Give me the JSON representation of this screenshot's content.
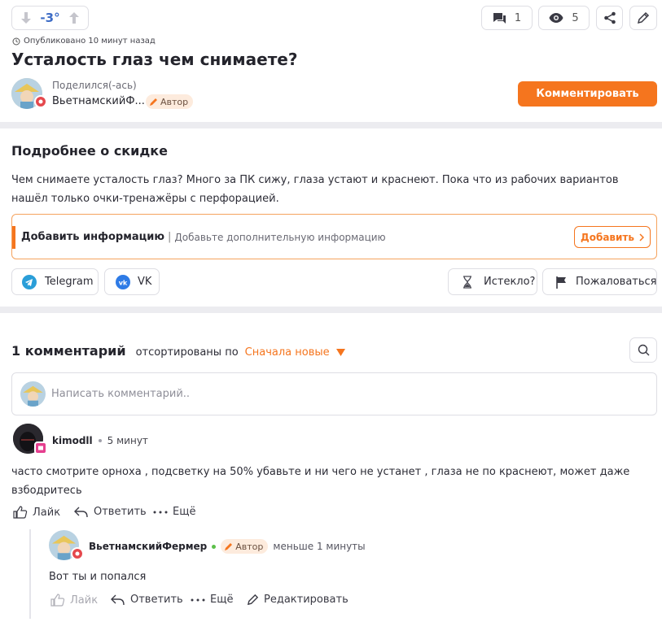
{
  "header": {
    "vote_value": "-3°",
    "comments_count": "1",
    "views_count": "5"
  },
  "post": {
    "published": "Опубликовано 10 минут назад",
    "title": "Усталость глаз чем снимаете?",
    "shared_label": "Поделился(-ась)",
    "author_name_truncated": "ВьетнамскийФ...",
    "author_tag": "Автор",
    "comment_button": "Комментировать"
  },
  "details": {
    "heading": "Подробнее о скидке",
    "body": "Чем снимаете усталость глаз? Много за ПК сижу, глаза устают и краснеют. Пока что из рабочих вариантов нашёл только очки-тренажёры с перфорацией.",
    "add_info_title": "Добавить информацию",
    "add_info_hint": "Добавьте дополнительную информацию",
    "add_button": "Добавить",
    "share_telegram": "Telegram",
    "share_vk": "VK",
    "expired_button": "Истекло?",
    "report_button": "Пожаловаться"
  },
  "comments": {
    "count_label": "1 комментарий",
    "sorted_label": "отсортированы по",
    "sort_value": "Сначала новые",
    "input_placeholder": "Написать комментарий..",
    "items": [
      {
        "author": "kimodll",
        "time": "5 минут",
        "text": "часто смотрите орноха , подсветку на 50% убавьте и ни чего не устанет , глаза не по краснеют, может даже взбодритесь",
        "like": "Лайк",
        "reply": "Ответить",
        "more": "Ещё"
      }
    ],
    "reply": {
      "author": "ВьетнамскийФермер",
      "tag": "Автор",
      "time": "меньше 1 минуты",
      "text": "Вот ты и попался",
      "like": "Лайк",
      "reply": "Ответить",
      "more": "Ещё",
      "edit": "Редактировать"
    }
  },
  "colors": {
    "accent": "#f5751e",
    "accent_light": "#fdebdd",
    "vote": "#3d6cc6",
    "online": "#5cc04a",
    "badge_red": "#e5484d",
    "badge_pink": "#e53f8f",
    "telegram": "#2a9ed8",
    "vk": "#2e7be6"
  }
}
